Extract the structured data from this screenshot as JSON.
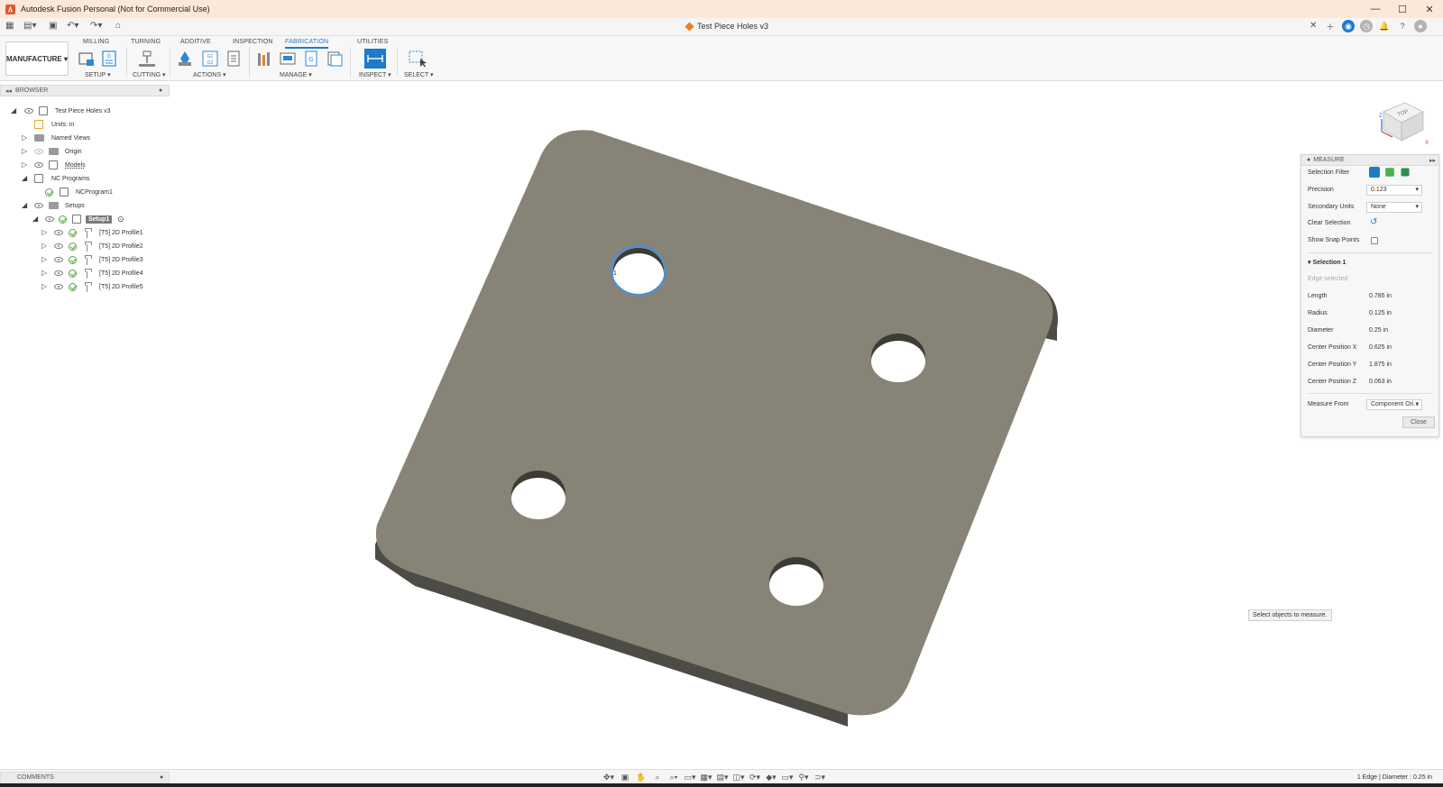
{
  "window": {
    "title": "Autodesk Fusion Personal (Not for Commercial Use)",
    "controls": [
      "—",
      "☐",
      "✕"
    ]
  },
  "document": {
    "tab_title": "Test Piece Holes v3"
  },
  "ribbon": {
    "workspace": "MANUFACTURE",
    "tabs": [
      "MILLING",
      "TURNING",
      "ADDITIVE",
      "INSPECTION",
      "FABRICATION",
      "UTILITIES"
    ],
    "active_tab": "FABRICATION",
    "groups": {
      "setup": "SETUP ▾",
      "cutting": "CUTTING ▾",
      "actions": "ACTIONS ▾",
      "manage": "MANAGE ▾",
      "inspect": "INSPECT ▾",
      "select": "SELECT ▾"
    },
    "gcode_label": "G1 G2"
  },
  "browser": {
    "header": "BROWSER",
    "items": [
      {
        "label": "Test Piece Holes v3"
      },
      {
        "label": "Units: in"
      },
      {
        "label": "Named Views"
      },
      {
        "label": "Origin"
      },
      {
        "label": "Models"
      },
      {
        "label": "NC Programs"
      },
      {
        "label": "NCProgram1"
      },
      {
        "label": "Setups"
      },
      {
        "label": "Setup1"
      },
      {
        "label": "[T5] 2D Profile1"
      },
      {
        "label": "[T5] 2D Profile2"
      },
      {
        "label": "[T5] 2D Profile3"
      },
      {
        "label": "[T5] 2D Profile4"
      },
      {
        "label": "[T5] 2D Profile5"
      }
    ]
  },
  "measure": {
    "header": "MEASURE",
    "selection_filter": "Selection Filter",
    "precision_label": "Precision",
    "precision_value": "0.123",
    "secondary_units_label": "Secondary Units",
    "secondary_units_value": "None",
    "clear_selection": "Clear Selection",
    "show_snap_points": "Show Snap Points",
    "selection_title": "Selection 1",
    "edge_selected": "Edge selected",
    "rows": [
      {
        "label": "Length",
        "value": "0.785 in"
      },
      {
        "label": "Radius",
        "value": "0.125 in"
      },
      {
        "label": "Diameter",
        "value": "0.25 in"
      },
      {
        "label": "Center Position X",
        "value": "0.625 in"
      },
      {
        "label": "Center Position Y",
        "value": "1.875 in"
      },
      {
        "label": "Center Position Z",
        "value": "0.063 in"
      }
    ],
    "measure_from_label": "Measure From",
    "measure_from_value": "Component Ori...",
    "close": "Close"
  },
  "viewcube": {
    "face": "TOP",
    "axis_z": "Z",
    "axis_x": "X"
  },
  "tooltip": "Select objects to measure.",
  "selection_marker": "1",
  "comments": "COMMENTS",
  "status": "1 Edge | Diameter : 0.25 in",
  "colors": {
    "accent": "#1f7acb",
    "plate_top": "#878377",
    "plate_side": "#4d4b45",
    "title_bar": "#fbe8d8"
  }
}
